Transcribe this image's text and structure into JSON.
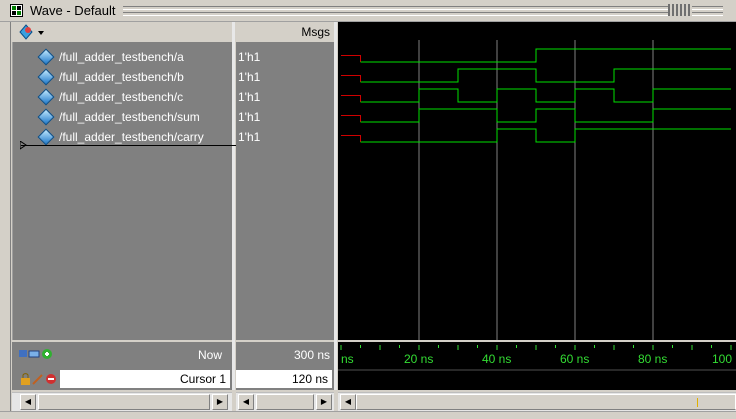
{
  "window": {
    "title": "Wave - Default"
  },
  "header": {
    "msgs_label": "Msgs"
  },
  "signals": [
    {
      "name": "/full_adder_testbench/a",
      "value": "1'h1"
    },
    {
      "name": "/full_adder_testbench/b",
      "value": "1'h1"
    },
    {
      "name": "/full_adder_testbench/c",
      "value": "1'h1"
    },
    {
      "name": "/full_adder_testbench/sum",
      "value": "1'h1"
    },
    {
      "name": "/full_adder_testbench/carry",
      "value": "1'h1"
    }
  ],
  "waveforms": {
    "time_unit": "ns",
    "initial_unknown_until": 5,
    "traces": [
      {
        "signal": "a",
        "transitions": [
          [
            5,
            0
          ],
          [
            50,
            1
          ]
        ]
      },
      {
        "signal": "b",
        "transitions": [
          [
            5,
            0
          ],
          [
            30,
            1
          ],
          [
            50,
            0
          ],
          [
            70,
            1
          ]
        ]
      },
      {
        "signal": "c",
        "transitions": [
          [
            5,
            0
          ],
          [
            20,
            1
          ],
          [
            30,
            0
          ],
          [
            40,
            1
          ],
          [
            50,
            0
          ],
          [
            60,
            1
          ],
          [
            70,
            0
          ],
          [
            80,
            1
          ]
        ]
      },
      {
        "signal": "sum",
        "transitions": [
          [
            5,
            0
          ],
          [
            20,
            1
          ],
          [
            40,
            0
          ],
          [
            50,
            1
          ],
          [
            60,
            0
          ],
          [
            80,
            1
          ]
        ]
      },
      {
        "signal": "carry",
        "transitions": [
          [
            5,
            0
          ],
          [
            40,
            1
          ],
          [
            50,
            0
          ],
          [
            60,
            1
          ]
        ]
      }
    ],
    "gridlines_ns": [
      20,
      40,
      60,
      80
    ],
    "colors": {
      "wave": "#00e000",
      "unknown": "#d00000",
      "grid": "#808080",
      "ruler": "#33dd33"
    }
  },
  "timeline": {
    "tick_labels": [
      "ns",
      "20 ns",
      "40 ns",
      "60 ns",
      "80 ns",
      "100"
    ]
  },
  "status": {
    "now_label": "Now",
    "now_value": "300 ns",
    "cursor_label": "Cursor 1",
    "cursor_value": "120 ns"
  },
  "icons": {
    "title": "wave-window-icon",
    "header": "signal-menu-icon",
    "now_row": [
      "add-wave-icon",
      "add-icon"
    ],
    "cursor_row": [
      "lock-icon",
      "edit-icon",
      "delete-icon"
    ]
  }
}
